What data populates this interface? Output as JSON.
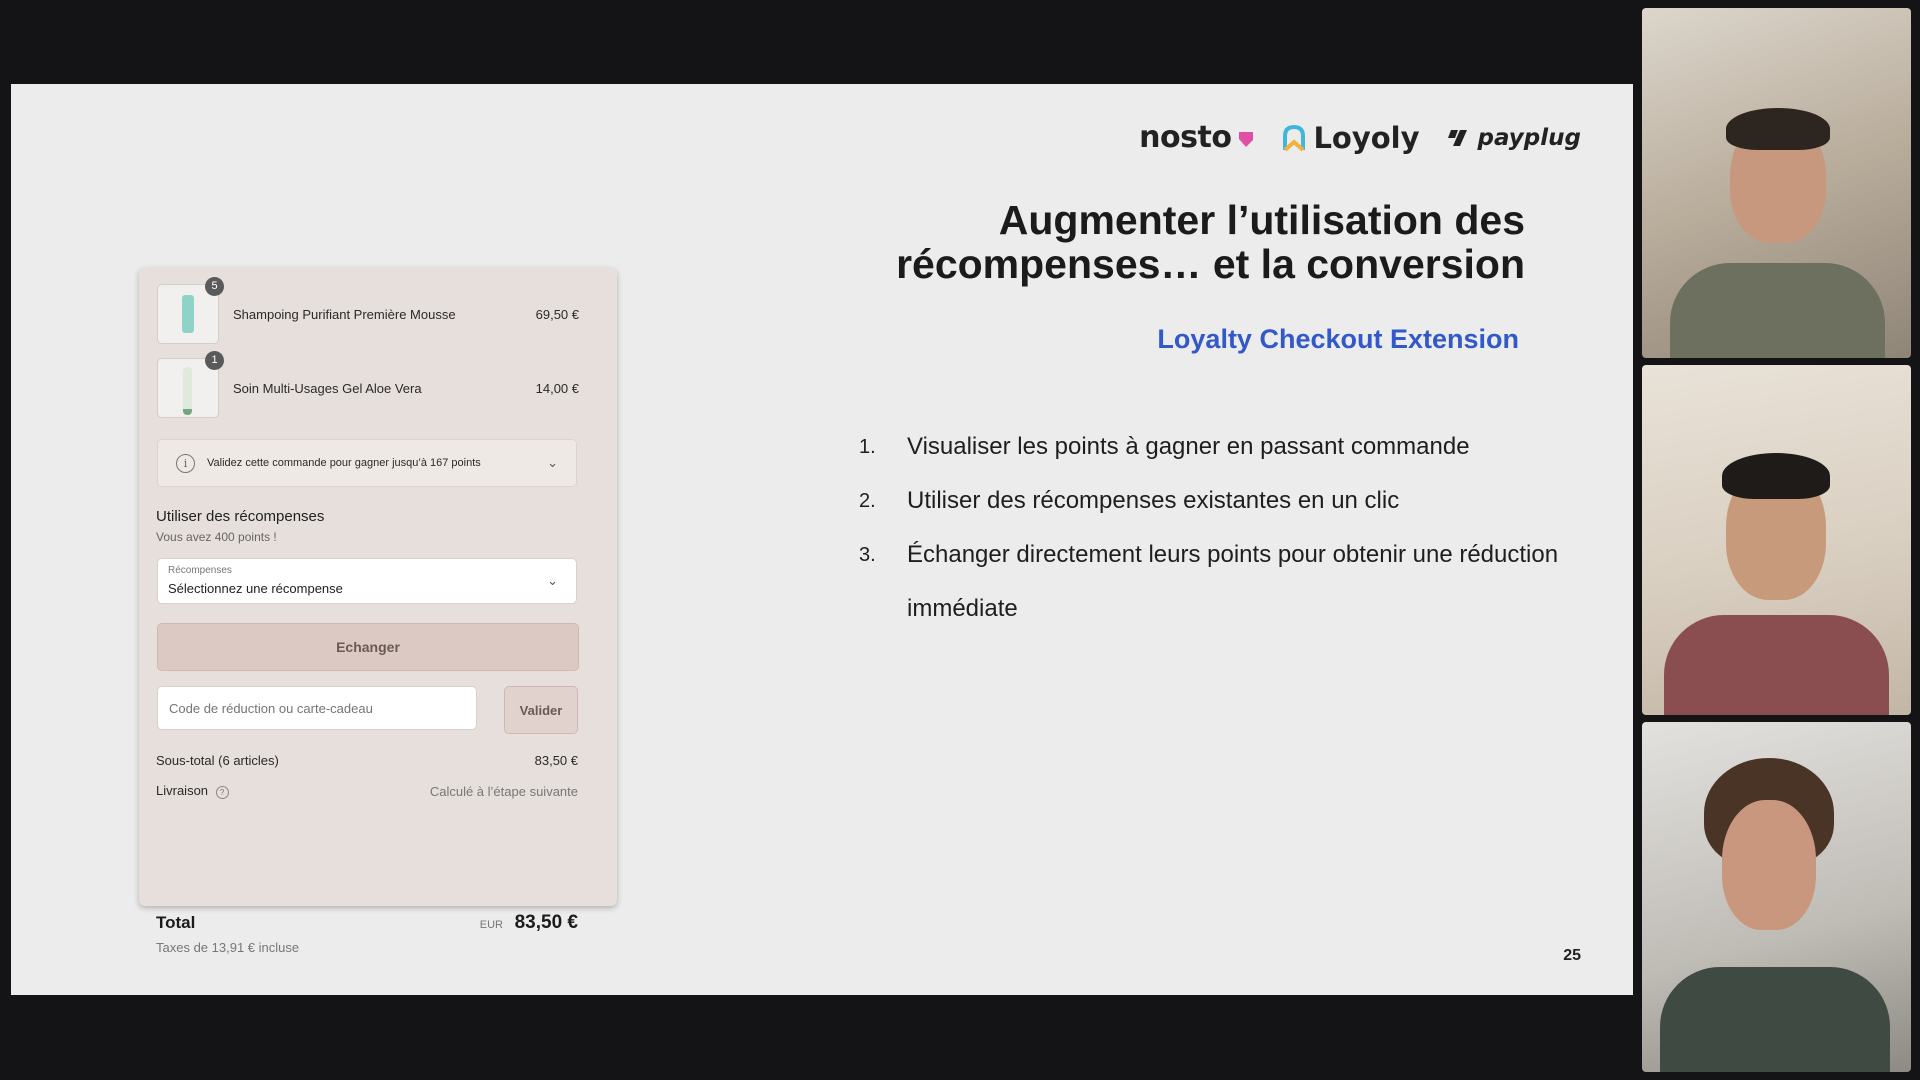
{
  "slide": {
    "logos": [
      "nosto",
      "Loyoly",
      "payplug"
    ],
    "title_line1": "Augmenter l’utilisation des",
    "title_line2": "récompenses… et la conversion",
    "subtitle": "Loyalty Checkout Extension",
    "steps": [
      {
        "num": "1.",
        "text": "Visualiser les points à gagner en passant commande"
      },
      {
        "num": "2.",
        "text": "Utiliser des récompenses existantes en un clic"
      },
      {
        "num": "3.",
        "text": "Échanger directement leurs points pour obtenir une réduction immédiate"
      }
    ],
    "page_number": "25"
  },
  "checkout": {
    "products": [
      {
        "qty": "5",
        "name": "Shampoing Purifiant Première Mousse",
        "price": "69,50 €"
      },
      {
        "qty": "1",
        "name": "Soin Multi-Usages Gel Aloe Vera",
        "price": "14,00 €"
      }
    ],
    "points_notice": "Validez cette commande pour gagner jusqu’à 167 points",
    "rewards_title": "Utiliser des récompenses",
    "rewards_sub": "Vous avez 400 points !",
    "select_label": "Récompenses",
    "select_value": "Sélectionnez une récompense",
    "exchange_label": "Echanger",
    "code_placeholder": "Code de réduction ou carte-cadeau",
    "validate_label": "Valider",
    "subtotal_label": "Sous-total (6 articles)",
    "subtotal_value": "83,50 €",
    "shipping_label": "Livraison",
    "shipping_value": "Calculé à l’étape suivante",
    "total_label": "Total",
    "total_currency": "EUR",
    "total_value": "83,50 €",
    "taxes": "Taxes de 13,91 € incluse"
  }
}
